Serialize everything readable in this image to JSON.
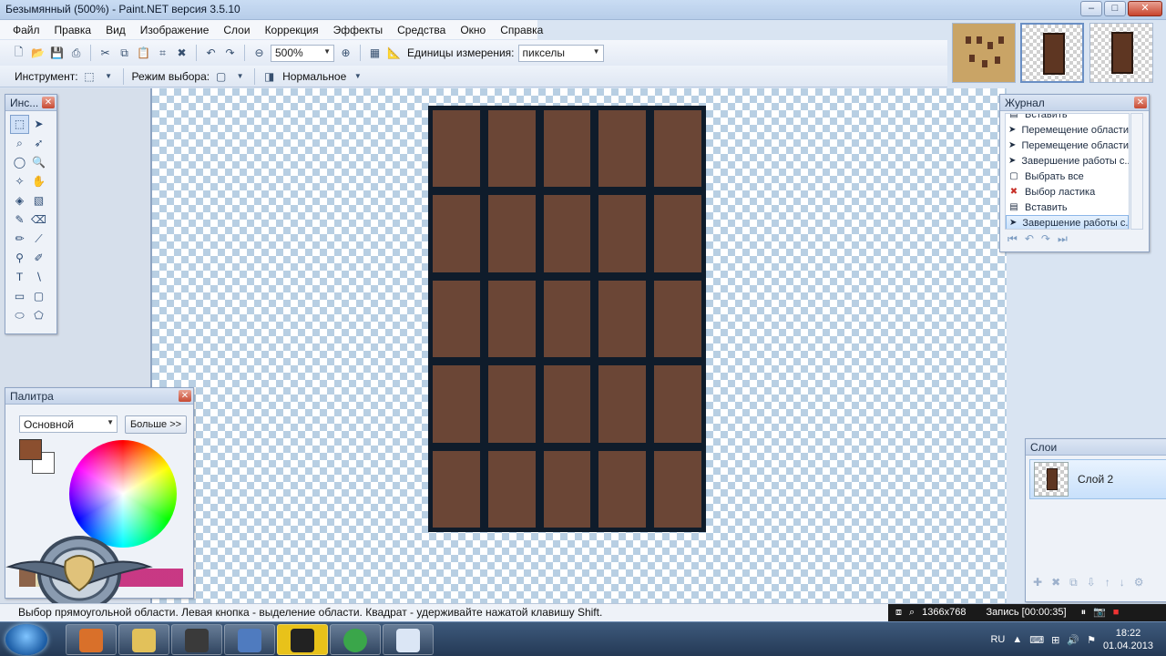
{
  "window": {
    "title": "Безымянный (500%) - Paint.NET версия 3.5.10",
    "controls": [
      "–",
      "□",
      "✕"
    ]
  },
  "menu": [
    "Файл",
    "Правка",
    "Вид",
    "Изображение",
    "Слои",
    "Коррекция",
    "Эффекты",
    "Средства",
    "Окно",
    "Справка"
  ],
  "toolbar": {
    "zoom_value": "500%",
    "units_label": "Единицы измерения:",
    "units_value": "пикселы"
  },
  "toolbar2": {
    "tool_label": "Инструмент:",
    "selection_mode_label": "Режим выбора:",
    "blend_mode": "Нормальное"
  },
  "tools_panel": {
    "title": "Инс...",
    "tools": [
      {
        "glyph": "⬚",
        "icon": "rect-select-icon"
      },
      {
        "glyph": "➤",
        "icon": "move-selection-icon"
      },
      {
        "glyph": "⌕",
        "icon": "lasso-select-icon"
      },
      {
        "glyph": "➶",
        "icon": "move-selected-icon"
      },
      {
        "glyph": "◯",
        "icon": "ellipse-select-icon"
      },
      {
        "glyph": "🔍",
        "icon": "zoom-icon"
      },
      {
        "glyph": "✧",
        "icon": "magic-wand-icon"
      },
      {
        "glyph": "✋",
        "icon": "pan-icon"
      },
      {
        "glyph": "◈",
        "icon": "paint-bucket-icon"
      },
      {
        "glyph": "▧",
        "icon": "gradient-icon"
      },
      {
        "glyph": "✎",
        "icon": "paintbrush-icon"
      },
      {
        "glyph": "⌫",
        "icon": "eraser-icon"
      },
      {
        "glyph": "✏",
        "icon": "pencil-icon"
      },
      {
        "glyph": "⟋",
        "icon": "color-picker-icon"
      },
      {
        "glyph": "⚲",
        "icon": "clone-stamp-icon"
      },
      {
        "glyph": "✐",
        "icon": "recolor-icon"
      },
      {
        "glyph": "T",
        "icon": "text-icon"
      },
      {
        "glyph": "∖",
        "icon": "line-curve-icon"
      },
      {
        "glyph": "▭",
        "icon": "rectangle-icon"
      },
      {
        "glyph": "▢",
        "icon": "rounded-rectangle-icon"
      },
      {
        "glyph": "⬭",
        "icon": "ellipse-icon"
      },
      {
        "glyph": "⬠",
        "icon": "freeform-shape-icon"
      }
    ]
  },
  "palette_panel": {
    "title": "Палитра",
    "mode": "Основной",
    "more_button": "Больше >>",
    "primary_color": "#8b4f2f",
    "secondary_color": "#ffffff"
  },
  "history_panel": {
    "title": "Журнал",
    "items": [
      {
        "label": "Вставить",
        "icon": "paste-icon"
      },
      {
        "label": "Перемещение области",
        "icon": "move-selection-icon"
      },
      {
        "label": "Перемещение области",
        "icon": "move-selection-icon"
      },
      {
        "label": "Завершение работы с...",
        "icon": "move-selection-icon"
      },
      {
        "label": "Выбрать все",
        "icon": "select-all-icon"
      },
      {
        "label": "Выбор ластика",
        "icon": "erase-selection-icon"
      },
      {
        "label": "Вставить",
        "icon": "paste-icon"
      },
      {
        "label": "Завершение работы с...",
        "icon": "move-selection-icon",
        "selected": true
      }
    ]
  },
  "layers_panel": {
    "title": "Слои",
    "layers": [
      {
        "name": "Слой 2"
      }
    ]
  },
  "canvas": {
    "image": "chocolate-bar",
    "grid_cols": 5,
    "grid_rows": 5,
    "cell_color": "#6b4636",
    "border_color": "#0f1c2b"
  },
  "status": {
    "hint": "Выбор прямоугольной области. Левая кнопка - выделение области. Квадрат - удерживайте нажатой клавишу Shift.",
    "resolution": "1366x768",
    "recording": "Запись [00:00:35]"
  },
  "taskbar": {
    "language": "RU",
    "time": "18:22",
    "date": "01.04.2013"
  }
}
